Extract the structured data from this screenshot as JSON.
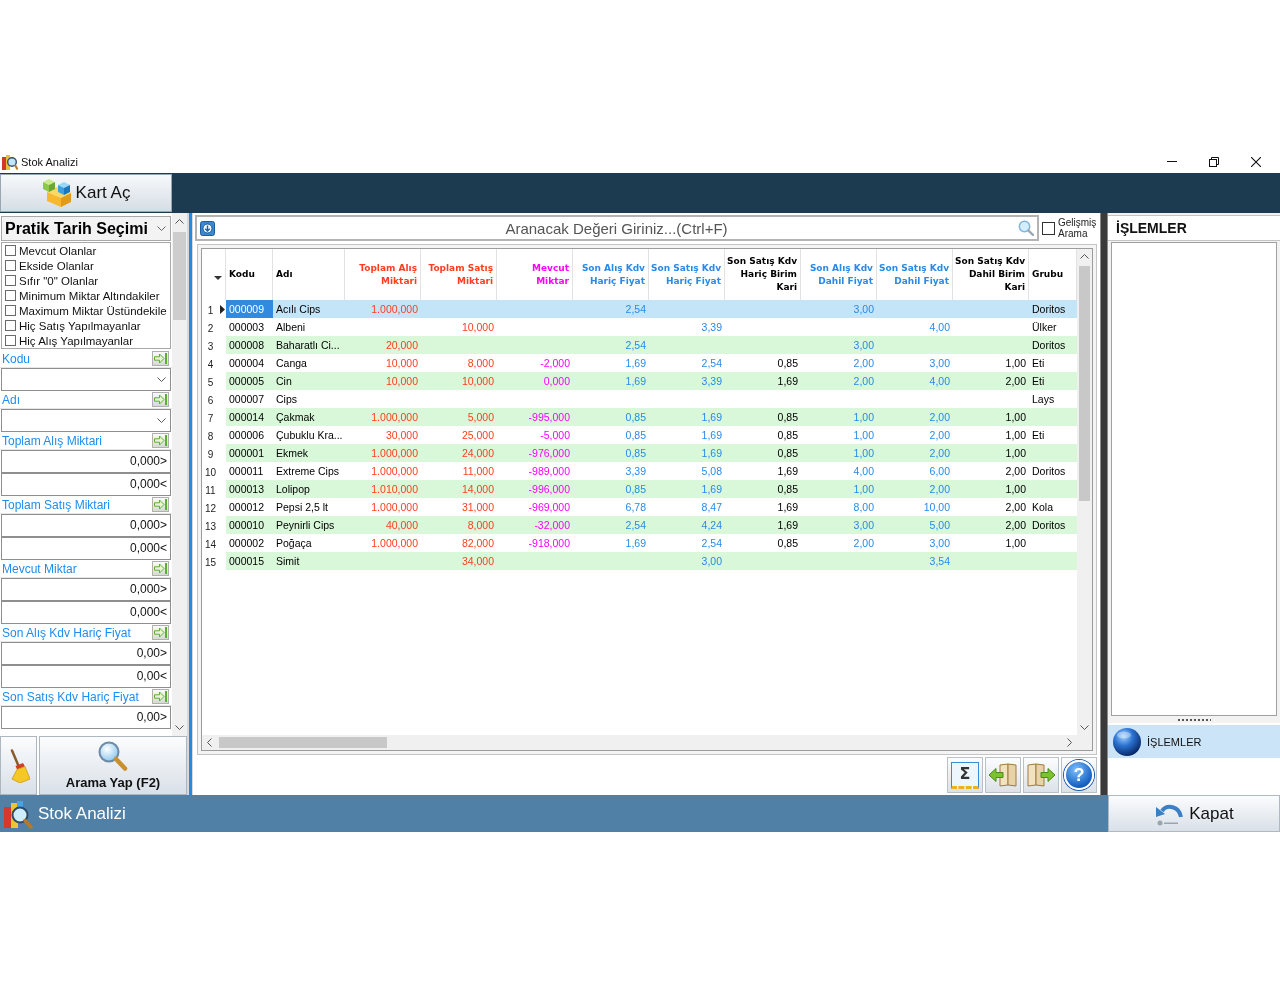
{
  "window": {
    "title": "Stok Analizi"
  },
  "toolbar": {
    "open_card_button": "Kart Aç"
  },
  "filter_panel": {
    "date_preset": "Pratik Tarih Seçimi",
    "checks": [
      {
        "label": "Mevcut Olanlar",
        "checked": false
      },
      {
        "label": "Ekside Olanlar",
        "checked": false
      },
      {
        "label": "Sıfır \"0\" Olanlar",
        "checked": false
      },
      {
        "label": "Minimum Miktar Altındakiler",
        "checked": false
      },
      {
        "label": "Maximum Miktar Üstündekile",
        "checked": false
      },
      {
        "label": "Hiç Satış Yapılmayanlar",
        "checked": false
      },
      {
        "label": "Hiç Alış Yapılmayanlar",
        "checked": false
      }
    ],
    "fields": [
      {
        "label": "Kodu",
        "kind": "combo"
      },
      {
        "label": "Adı",
        "kind": "combo"
      },
      {
        "label": "Toplam Alış Miktari",
        "kind": "range",
        "values": [
          "0,000>",
          "0,000<"
        ]
      },
      {
        "label": "Toplam Satış Miktari",
        "kind": "range",
        "values": [
          "0,000>",
          "0,000<"
        ]
      },
      {
        "label": "Mevcut Miktar",
        "kind": "range",
        "values": [
          "0,000>",
          "0,000<"
        ]
      },
      {
        "label": "Son Alış Kdv Hariç Fiyat",
        "kind": "range",
        "values": [
          "0,00>",
          "0,00<"
        ]
      },
      {
        "label": "Son Satış Kdv Hariç Fiyat",
        "kind": "range",
        "values": [
          "0,00>"
        ]
      }
    ],
    "search_button": "Arama Yap (F2)"
  },
  "search": {
    "placeholder": "Aranacak Değeri Giriniz...(Ctrl+F)",
    "advanced": {
      "label": "Gelişmiş Arama",
      "checked": false
    }
  },
  "table": {
    "columns": [
      {
        "label": "Kodu",
        "kind": "text",
        "color": "#000000"
      },
      {
        "label": "Adı",
        "kind": "text",
        "color": "#000000"
      },
      {
        "label": "Toplam Alış Miktari",
        "kind": "number",
        "color": "#ff3d1f"
      },
      {
        "label": "Toplam Satış Miktari",
        "kind": "number",
        "color": "#ff3d1f"
      },
      {
        "label": "Mevcut Miktar",
        "kind": "number",
        "color": "#ff00ff"
      },
      {
        "label": "Son Alış Kdv Hariç Fiyat",
        "kind": "number",
        "color": "#2a8ae8"
      },
      {
        "label": "Son Satış Kdv Hariç Fiyat",
        "kind": "number",
        "color": "#2a8ae8"
      },
      {
        "label": "Son Satış Kdv Hariç Birim Kari",
        "kind": "number",
        "color": "#000000"
      },
      {
        "label": "Son Alış Kdv Dahil Fiyat",
        "kind": "number",
        "color": "#2a8ae8"
      },
      {
        "label": "Son Satış Kdv Dahil Fiyat",
        "kind": "number",
        "color": "#2a8ae8"
      },
      {
        "label": "Son Satış Kdv Dahil Birim Kari",
        "kind": "number",
        "color": "#000000"
      },
      {
        "label": "Grubu",
        "kind": "text",
        "color": "#000000"
      }
    ],
    "rows": [
      {
        "number": "1",
        "selected": true,
        "cells": [
          "000009",
          "Acılı Cips",
          "1.000,000",
          null,
          null,
          "2,54",
          null,
          null,
          "3,00",
          null,
          null,
          "Doritos"
        ]
      },
      {
        "number": "2",
        "selected": false,
        "cells": [
          "000003",
          "Albeni",
          null,
          "10,000",
          null,
          null,
          "3,39",
          null,
          null,
          "4,00",
          null,
          "Ülker"
        ]
      },
      {
        "number": "3",
        "selected": false,
        "cells": [
          "000008",
          "Baharatlı Ci...",
          "20,000",
          null,
          null,
          "2,54",
          null,
          null,
          "3,00",
          null,
          null,
          "Doritos"
        ]
      },
      {
        "number": "4",
        "selected": false,
        "cells": [
          "000004",
          "Canga",
          "10,000",
          "8,000",
          "-2,000",
          "1,69",
          "2,54",
          "0,85",
          "2,00",
          "3,00",
          "1,00",
          "Eti"
        ]
      },
      {
        "number": "5",
        "selected": false,
        "cells": [
          "000005",
          "Cin",
          "10,000",
          "10,000",
          "0,000",
          "1,69",
          "3,39",
          "1,69",
          "2,00",
          "4,00",
          "2,00",
          "Eti"
        ]
      },
      {
        "number": "6",
        "selected": false,
        "cells": [
          "000007",
          "Cips",
          null,
          null,
          null,
          null,
          null,
          null,
          null,
          null,
          null,
          "Lays"
        ]
      },
      {
        "number": "7",
        "selected": false,
        "cells": [
          "000014",
          "Çakmak",
          "1.000,000",
          "5,000",
          "-995,000",
          "0,85",
          "1,69",
          "0,85",
          "1,00",
          "2,00",
          "1,00",
          null
        ]
      },
      {
        "number": "8",
        "selected": false,
        "cells": [
          "000006",
          "Çubuklu Kra...",
          "30,000",
          "25,000",
          "-5,000",
          "0,85",
          "1,69",
          "0,85",
          "1,00",
          "2,00",
          "1,00",
          "Eti"
        ]
      },
      {
        "number": "9",
        "selected": false,
        "cells": [
          "000001",
          "Ekmek",
          "1.000,000",
          "24,000",
          "-976,000",
          "0,85",
          "1,69",
          "0,85",
          "1,00",
          "2,00",
          "1,00",
          null
        ]
      },
      {
        "number": "10",
        "selected": false,
        "cells": [
          "000011",
          "Extreme Cips",
          "1.000,000",
          "11,000",
          "-989,000",
          "3,39",
          "5,08",
          "1,69",
          "4,00",
          "6,00",
          "2,00",
          "Doritos"
        ]
      },
      {
        "number": "11",
        "selected": false,
        "cells": [
          "000013",
          "Lolipop",
          "1.010,000",
          "14,000",
          "-996,000",
          "0,85",
          "1,69",
          "0,85",
          "1,00",
          "2,00",
          "1,00",
          null
        ]
      },
      {
        "number": "12",
        "selected": false,
        "cells": [
          "000012",
          "Pepsi 2,5 lt",
          "1.000,000",
          "31,000",
          "-969,000",
          "6,78",
          "8,47",
          "1,69",
          "8,00",
          "10,00",
          "2,00",
          "Kola"
        ]
      },
      {
        "number": "13",
        "selected": false,
        "cells": [
          "000010",
          "Peynirli Cips",
          "40,000",
          "8,000",
          "-32,000",
          "2,54",
          "4,24",
          "1,69",
          "3,00",
          "5,00",
          "2,00",
          "Doritos"
        ]
      },
      {
        "number": "14",
        "selected": false,
        "cells": [
          "000002",
          "Poğaça",
          "1.000,000",
          "82,000",
          "-918,000",
          "1,69",
          "2,54",
          "0,85",
          "2,00",
          "3,00",
          "1,00",
          null
        ]
      },
      {
        "number": "15",
        "selected": false,
        "cells": [
          "000015",
          "Simit",
          null,
          "34,000",
          null,
          null,
          "3,00",
          null,
          null,
          "3,54",
          null,
          null
        ]
      }
    ]
  },
  "bottom_toolbar": {
    "sum_button": "Σ",
    "help_button": "?"
  },
  "actions_panel": {
    "title": "İŞLEMLER",
    "items": [
      {
        "label": "İŞLEMLER",
        "selected": true
      }
    ]
  },
  "status_bar": {
    "title": "Stok Analizi",
    "close_button": "Kapat"
  }
}
